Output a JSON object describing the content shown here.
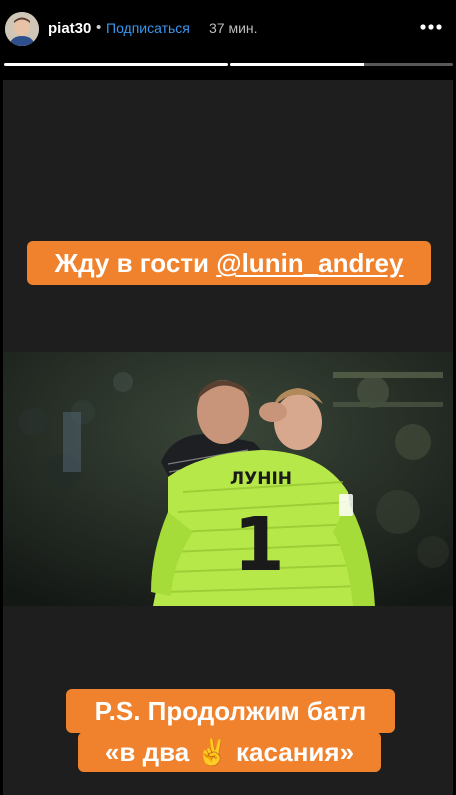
{
  "header": {
    "username": "piat30",
    "separator": "•",
    "subscribe_label": "Подписаться",
    "time_ago": "37 мин.",
    "more_icon": "more-horizontal-icon"
  },
  "progress": [
    {
      "fill": 1.0
    },
    {
      "fill": 0.6
    }
  ],
  "stickers": {
    "top_text": "Жду в гости ",
    "top_mention": "@lunin_andrey",
    "bottom_line1": "P.S. Продолжим батл",
    "bottom_line2_part1": "«в два ",
    "bottom_line2_emoji": "✌",
    "bottom_line2_part2": " касания»"
  },
  "photo": {
    "jersey_name": "ЛУНІН",
    "jersey_number": "1"
  },
  "colors": {
    "accent": "#3897f0",
    "sticker": "#f0822d",
    "jersey": "#b7e84a",
    "background": "#1e1e1e"
  }
}
